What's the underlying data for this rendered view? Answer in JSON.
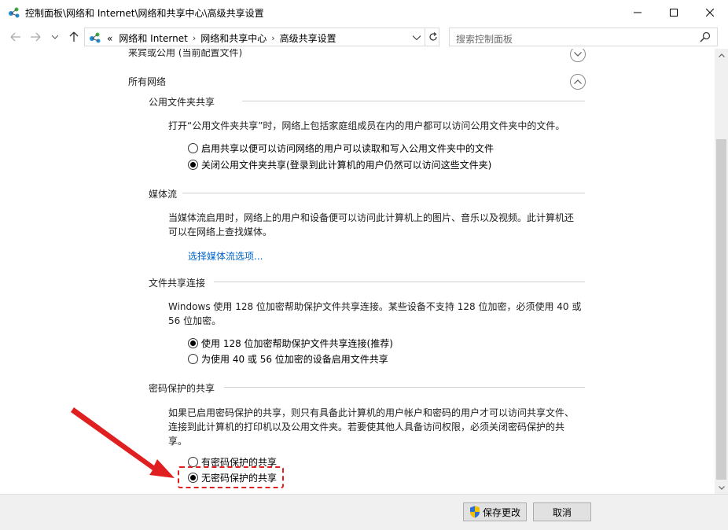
{
  "window": {
    "title": "控制面板\\网络和 Internet\\网络和共享中心\\高级共享设置",
    "minimize_icon": "minimize-icon",
    "maximize_icon": "maximize-icon",
    "close_icon": "close-icon"
  },
  "addressbar": {
    "overflow": "«",
    "crumbs": [
      "网络和 Internet",
      "网络和共享中心",
      "高级共享设置"
    ],
    "search_placeholder": "搜索控制面板"
  },
  "sections": {
    "partial_header": "来宾或公用 (当前配置文件)",
    "all_networks": "所有网络",
    "public_folder": {
      "title": "公用文件夹共享",
      "desc": "打开“公用文件夹共享”时，网络上包括家庭组成员在内的用户都可以访问公用文件夹中的文件。",
      "options": [
        {
          "label": "启用共享以便可以访问网络的用户可以读取和写入公用文件夹中的文件",
          "selected": false
        },
        {
          "label": "关闭公用文件夹共享(登录到此计算机的用户仍然可以访问这些文件夹)",
          "selected": true
        }
      ]
    },
    "media": {
      "title": "媒体流",
      "desc_line1": "当媒体流启用时，网络上的用户和设备便可以访问此计算机上的图片、音乐以及视频。此计算机还",
      "desc_line2": "可以在网络上查找媒体。",
      "link": "选择媒体流选项..."
    },
    "file_sharing": {
      "title": "文件共享连接",
      "desc_line1": "Windows 使用 128 位加密帮助保护文件共享连接。某些设备不支持 128 位加密，必须使用 40 或",
      "desc_line2": "56 位加密。",
      "options": [
        {
          "label": "使用 128 位加密帮助保护文件共享连接(推荐)",
          "selected": true
        },
        {
          "label": "为使用 40 或 56 位加密的设备启用文件共享",
          "selected": false
        }
      ]
    },
    "password": {
      "title": "密码保护的共享",
      "desc_line1": "如果已启用密码保护的共享，则只有具备此计算机的用户帐户和密码的用户才可以访问共享文件、",
      "desc_line2": "连接到此计算机的打印机以及公用文件夹。若要使其他人具备访问权限，必须关闭密码保护的共",
      "desc_line3": "享。",
      "options": [
        {
          "label": "有密码保护的共享",
          "selected": false
        },
        {
          "label": "无密码保护的共享",
          "selected": true
        }
      ]
    }
  },
  "footer": {
    "save": "保存更改",
    "cancel": "取消"
  },
  "colors": {
    "annotation": "#e02020",
    "link": "#0066cc"
  }
}
